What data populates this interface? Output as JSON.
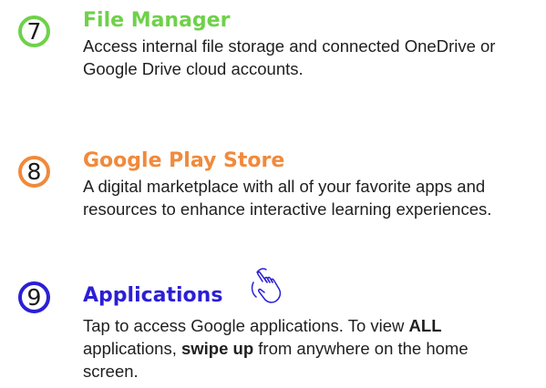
{
  "sections": [
    {
      "number": "7",
      "title": "File Manager",
      "description": "Access internal file storage and connected OneDrive or Google Drive cloud accounts.",
      "color": "#6fd14a"
    },
    {
      "number": "8",
      "title": "Google Play Store",
      "description": "A digital marketplace with all of your favorite apps and resources to enhance interactive learning experiences.",
      "color": "#f08a3c"
    },
    {
      "number": "9",
      "title": "Applications",
      "icon": "tap-hand-icon",
      "description_parts": {
        "a": "Tap to access Google applications.  To view ",
        "b": "ALL",
        "c": " applications, ",
        "d": "swipe up",
        "e": " from anywhere on the home screen."
      },
      "color": "#2b1fd6"
    }
  ]
}
